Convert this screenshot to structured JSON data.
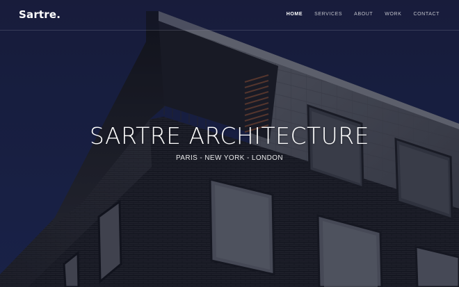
{
  "header": {
    "logo": "Sartre."
  },
  "nav": {
    "items": [
      {
        "label": "HOME",
        "active": true
      },
      {
        "label": "SERVICES",
        "active": false
      },
      {
        "label": "ABOUT",
        "active": false
      },
      {
        "label": "WORK",
        "active": false
      },
      {
        "label": "CONTACT",
        "active": false
      }
    ]
  },
  "hero": {
    "title": "SARTRE ARCHITECTURE",
    "subtitle": "PARIS - NEW YORK - LONDON"
  },
  "colors": {
    "sky": "#1b2240",
    "building_dark": "#242529",
    "building_light": "#5c5f66",
    "text": "#ffffff"
  }
}
